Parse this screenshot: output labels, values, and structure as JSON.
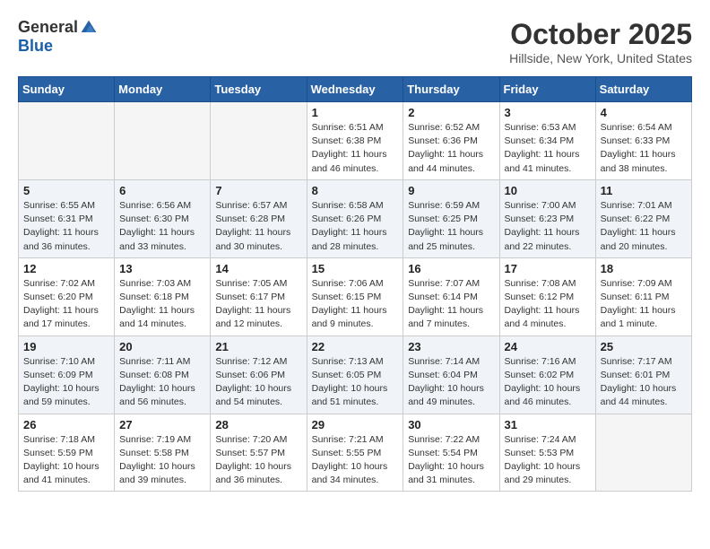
{
  "header": {
    "logo_general": "General",
    "logo_blue": "Blue",
    "month": "October 2025",
    "location": "Hillside, New York, United States"
  },
  "weekdays": [
    "Sunday",
    "Monday",
    "Tuesday",
    "Wednesday",
    "Thursday",
    "Friday",
    "Saturday"
  ],
  "weeks": [
    [
      {
        "day": "",
        "info": ""
      },
      {
        "day": "",
        "info": ""
      },
      {
        "day": "",
        "info": ""
      },
      {
        "day": "1",
        "info": "Sunrise: 6:51 AM\nSunset: 6:38 PM\nDaylight: 11 hours\nand 46 minutes."
      },
      {
        "day": "2",
        "info": "Sunrise: 6:52 AM\nSunset: 6:36 PM\nDaylight: 11 hours\nand 44 minutes."
      },
      {
        "day": "3",
        "info": "Sunrise: 6:53 AM\nSunset: 6:34 PM\nDaylight: 11 hours\nand 41 minutes."
      },
      {
        "day": "4",
        "info": "Sunrise: 6:54 AM\nSunset: 6:33 PM\nDaylight: 11 hours\nand 38 minutes."
      }
    ],
    [
      {
        "day": "5",
        "info": "Sunrise: 6:55 AM\nSunset: 6:31 PM\nDaylight: 11 hours\nand 36 minutes."
      },
      {
        "day": "6",
        "info": "Sunrise: 6:56 AM\nSunset: 6:30 PM\nDaylight: 11 hours\nand 33 minutes."
      },
      {
        "day": "7",
        "info": "Sunrise: 6:57 AM\nSunset: 6:28 PM\nDaylight: 11 hours\nand 30 minutes."
      },
      {
        "day": "8",
        "info": "Sunrise: 6:58 AM\nSunset: 6:26 PM\nDaylight: 11 hours\nand 28 minutes."
      },
      {
        "day": "9",
        "info": "Sunrise: 6:59 AM\nSunset: 6:25 PM\nDaylight: 11 hours\nand 25 minutes."
      },
      {
        "day": "10",
        "info": "Sunrise: 7:00 AM\nSunset: 6:23 PM\nDaylight: 11 hours\nand 22 minutes."
      },
      {
        "day": "11",
        "info": "Sunrise: 7:01 AM\nSunset: 6:22 PM\nDaylight: 11 hours\nand 20 minutes."
      }
    ],
    [
      {
        "day": "12",
        "info": "Sunrise: 7:02 AM\nSunset: 6:20 PM\nDaylight: 11 hours\nand 17 minutes."
      },
      {
        "day": "13",
        "info": "Sunrise: 7:03 AM\nSunset: 6:18 PM\nDaylight: 11 hours\nand 14 minutes."
      },
      {
        "day": "14",
        "info": "Sunrise: 7:05 AM\nSunset: 6:17 PM\nDaylight: 11 hours\nand 12 minutes."
      },
      {
        "day": "15",
        "info": "Sunrise: 7:06 AM\nSunset: 6:15 PM\nDaylight: 11 hours\nand 9 minutes."
      },
      {
        "day": "16",
        "info": "Sunrise: 7:07 AM\nSunset: 6:14 PM\nDaylight: 11 hours\nand 7 minutes."
      },
      {
        "day": "17",
        "info": "Sunrise: 7:08 AM\nSunset: 6:12 PM\nDaylight: 11 hours\nand 4 minutes."
      },
      {
        "day": "18",
        "info": "Sunrise: 7:09 AM\nSunset: 6:11 PM\nDaylight: 11 hours\nand 1 minute."
      }
    ],
    [
      {
        "day": "19",
        "info": "Sunrise: 7:10 AM\nSunset: 6:09 PM\nDaylight: 10 hours\nand 59 minutes."
      },
      {
        "day": "20",
        "info": "Sunrise: 7:11 AM\nSunset: 6:08 PM\nDaylight: 10 hours\nand 56 minutes."
      },
      {
        "day": "21",
        "info": "Sunrise: 7:12 AM\nSunset: 6:06 PM\nDaylight: 10 hours\nand 54 minutes."
      },
      {
        "day": "22",
        "info": "Sunrise: 7:13 AM\nSunset: 6:05 PM\nDaylight: 10 hours\nand 51 minutes."
      },
      {
        "day": "23",
        "info": "Sunrise: 7:14 AM\nSunset: 6:04 PM\nDaylight: 10 hours\nand 49 minutes."
      },
      {
        "day": "24",
        "info": "Sunrise: 7:16 AM\nSunset: 6:02 PM\nDaylight: 10 hours\nand 46 minutes."
      },
      {
        "day": "25",
        "info": "Sunrise: 7:17 AM\nSunset: 6:01 PM\nDaylight: 10 hours\nand 44 minutes."
      }
    ],
    [
      {
        "day": "26",
        "info": "Sunrise: 7:18 AM\nSunset: 5:59 PM\nDaylight: 10 hours\nand 41 minutes."
      },
      {
        "day": "27",
        "info": "Sunrise: 7:19 AM\nSunset: 5:58 PM\nDaylight: 10 hours\nand 39 minutes."
      },
      {
        "day": "28",
        "info": "Sunrise: 7:20 AM\nSunset: 5:57 PM\nDaylight: 10 hours\nand 36 minutes."
      },
      {
        "day": "29",
        "info": "Sunrise: 7:21 AM\nSunset: 5:55 PM\nDaylight: 10 hours\nand 34 minutes."
      },
      {
        "day": "30",
        "info": "Sunrise: 7:22 AM\nSunset: 5:54 PM\nDaylight: 10 hours\nand 31 minutes."
      },
      {
        "day": "31",
        "info": "Sunrise: 7:24 AM\nSunset: 5:53 PM\nDaylight: 10 hours\nand 29 minutes."
      },
      {
        "day": "",
        "info": ""
      }
    ]
  ]
}
